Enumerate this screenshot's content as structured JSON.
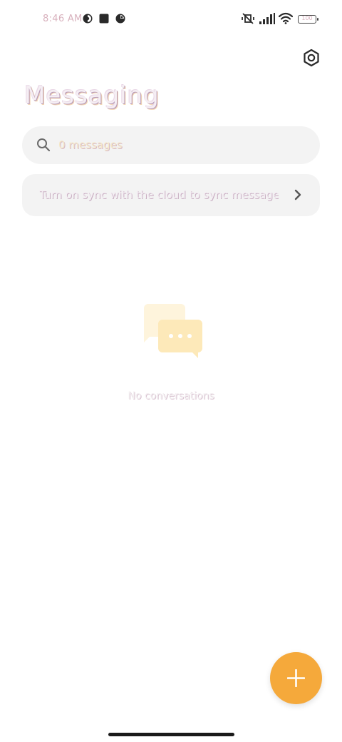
{
  "status_bar": {
    "time": "8:46 AM",
    "battery": "100"
  },
  "header": {
    "title": "Messaging",
    "settings_icon": "settings-hex-icon"
  },
  "search": {
    "placeholder": "0 messages",
    "icon": "search-icon"
  },
  "sync_banner": {
    "text": "Turn on sync with the cloud to sync messages",
    "icon": "chevron-right-icon"
  },
  "empty_state": {
    "text": "No conversations",
    "icon": "chat-bubbles-icon"
  },
  "fab": {
    "icon": "plus-icon"
  },
  "colors": {
    "accent": "#f5a93b",
    "card_bg": "#f3f3f3",
    "illustration": "#fde9b9"
  }
}
